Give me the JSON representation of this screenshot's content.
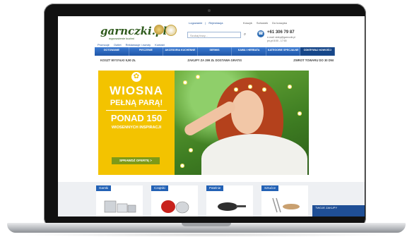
{
  "brand": {
    "logo": "garnczki.pl",
    "tagline": "wyposażenie kuchni"
  },
  "header": {
    "account_links": [
      "Logowanie",
      "Rejestracja"
    ],
    "top_links": [
      "Koszyk",
      "Schowek",
      "Do koszyka"
    ],
    "search_placeholder": "Szukaj frazy...",
    "phone": "+61 306 79 87",
    "email": "e-mail: sklep@garnczki.pl",
    "hours": "pn-pt 8:00 - 17:00"
  },
  "sublinks": [
    "Promocje",
    "Outlet",
    "Reklamacje i zwroty",
    "Kontakt"
  ],
  "nav": [
    {
      "label": "GOTOWANIE"
    },
    {
      "label": "PIECZENIE"
    },
    {
      "label": "AKCESORIA KUCHENNE"
    },
    {
      "label": "SERWIS"
    },
    {
      "label": "KAWA I HERBATA"
    },
    {
      "label": "KATEGORIE SPECJALNE"
    },
    {
      "label": "ODKRYWAJ NOWOŚCI"
    }
  ],
  "promos": [
    "KOSZT WYSYŁKI 9,90 ZŁ",
    "ZAKUPY ZA 299 ZŁ DOSTAWA GRATIS",
    "ZWROT TOWARU DO 30 DNI"
  ],
  "hero": {
    "line1": "WIOSNA",
    "line2": "PEŁNĄ PARĄ!",
    "line3": "PONAD 150",
    "line4": "WIOSENNYCH INSPIRACJI",
    "cta": "SPRAWDŹ OFERTĘ  >"
  },
  "categories": [
    {
      "label": "Garnki"
    },
    {
      "label": "Czajniki"
    },
    {
      "label": "Patelnie"
    },
    {
      "label": "Sztućce"
    }
  ],
  "basket_label": "TWOJE ZAKUPY",
  "colors": {
    "nav_blue": "#1f56a8",
    "hero_yellow": "#f3c300",
    "cta_green": "#7d9a18",
    "category_blue": "#2261b5"
  }
}
